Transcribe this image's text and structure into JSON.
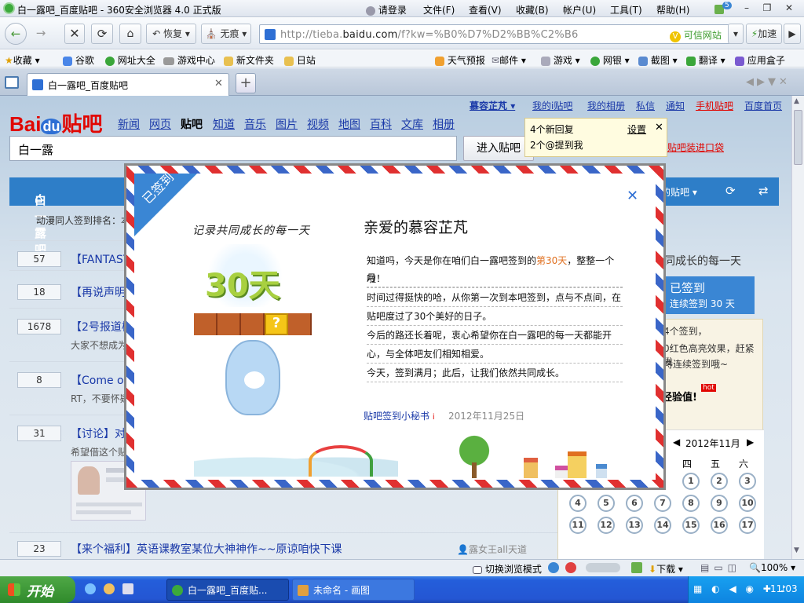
{
  "window": {
    "title": "白一露吧_百度贴吧 - 360安全浏览器 4.0 正式版"
  },
  "titlemenu": {
    "login": "请登录",
    "file": "文件(F)",
    "view": "查看(V)",
    "favorites": "收藏(B)",
    "account": "帐户(U)",
    "tools": "工具(T)",
    "help": "帮助(H)",
    "badge": "5"
  },
  "navbar": {
    "restore": "恢复",
    "incognito": "无痕",
    "url_prefix": "http://tieba.",
    "url_domain": "baidu.com",
    "url_rest": "/f?kw=%B0%D7%D2%BB%C2%B6",
    "trusted": "可信网站",
    "speedup": "加速"
  },
  "bookmarks": {
    "left": [
      "收藏",
      "谷歌",
      "网址大全",
      "游戏中心",
      "新文件夹",
      "日站"
    ],
    "right": [
      "天气预报",
      "邮件",
      "游戏",
      "网银",
      "截图",
      "翻译",
      "应用盒子"
    ]
  },
  "tab": {
    "title": "白一露吧_百度贴吧"
  },
  "page": {
    "logo_bai": "Bai",
    "logo_du": "du",
    "logo_tieba": "贴吧",
    "nav": [
      "新闻",
      "网页",
      "贴吧",
      "知道",
      "音乐",
      "图片",
      "视频",
      "地图",
      "百科",
      "文库",
      "相册"
    ],
    "search_value": "白一露",
    "enter_button": "进入贴吧",
    "user": "慕容芷芃",
    "toplinks": [
      "我的i贴吧",
      "我的相册",
      "私信",
      "通知",
      "手机贴吧",
      "百度首页"
    ],
    "notif_replies": "4个新回复",
    "notif_mention": "2个@提到我",
    "notif_settings": "设置",
    "red_link": "贴吧装进口袋",
    "forum_name": "白一露吧",
    "my_forum": "的贴吧",
    "rank_text": "动漫同人签到排名：本",
    "rows": [
      {
        "count": "57",
        "title": "【FANTASY"
      },
      {
        "count": "18",
        "title": "【再说声明】"
      },
      {
        "count": "1678",
        "title": "【2号报道楼",
        "sub": "大家不想成为"
      },
      {
        "count": "8",
        "title": "【Come on",
        "sub": "RT，不要怀疑"
      },
      {
        "count": "31",
        "title": "【讨论】对白",
        "sub": "希望借这个贴"
      },
      {
        "count": "23",
        "title": "【来个福利】英语课教室某位大神神作~~原谅咱快下课",
        "author": "露女王all天道"
      }
    ],
    "right_slogan": "同成长的每一天",
    "signed_title": "已签到",
    "signed_days": "连续签到 30 天",
    "right_text1": "4个签到，",
    "right_text2": "0红色高亮效果，赶紧发",
    "right_text3": "持连续签到哦~",
    "exp_label": "经验值!",
    "hot": "hot",
    "cal_month": "2012年11月",
    "cal_weekdays": [
      "四",
      "五",
      "六"
    ],
    "cal_row1": [
      "1",
      "2",
      "3"
    ],
    "cal_row2": [
      "4",
      "5",
      "6",
      "7",
      "8",
      "9",
      "10"
    ],
    "cal_row3": [
      "11",
      "12",
      "13",
      "14",
      "15",
      "16",
      "17"
    ]
  },
  "modal": {
    "ribbon": "已签到",
    "handwritten": "记录共同成长的每一天",
    "badge_text": "30天",
    "greeting": "亲爱的慕容芷芃",
    "line1a": "知道吗，今天是你在咱们白一露吧签到的",
    "line1b": "第30天",
    "line1c": "，整整一个月",
    "line2": "啦！",
    "line3": "时间过得挺快的哈，从你第一次到本吧签到，点与不点间，在",
    "line4": "贴吧度过了30个美好的日子。",
    "line5": "今后的路还长着呢，衷心希望你在白一露吧的每一天都能开",
    "line6": "心，与全体吧友们相知相爱。",
    "line7": "今天，签到满月；此后，让我们依然共同成长。",
    "signature": "贴吧签到小秘书",
    "date": "2012年11月25日"
  },
  "statusbar": {
    "switch_mode": "切换浏览模式",
    "download": "下载",
    "zoom": "100%"
  },
  "taskbar": {
    "start": "开始",
    "task1": "白一露吧_百度贴...",
    "task2": "未命名 - 画图",
    "time": "11:03"
  },
  "colors": {
    "accent_blue": "#2e7ec8",
    "baidu_red": "#e10601",
    "link": "#1a39a8",
    "highlight": "#e07020"
  }
}
